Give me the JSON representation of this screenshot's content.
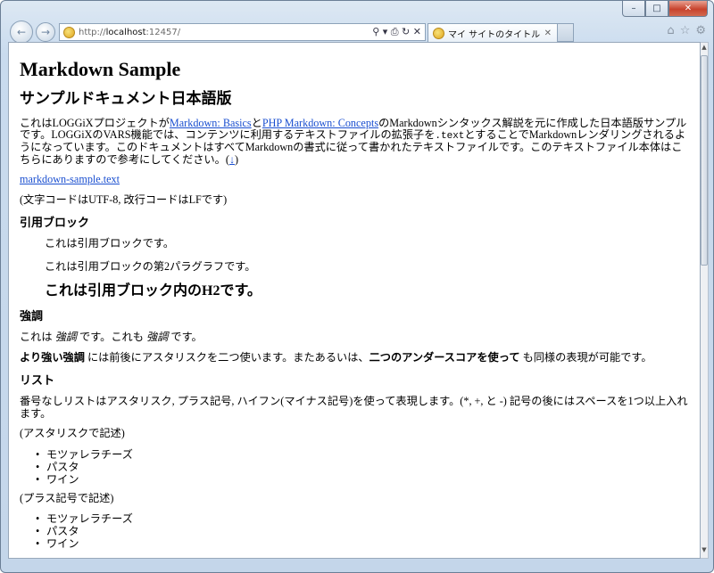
{
  "window": {
    "minimize_glyph": "–",
    "maximize_glyph": "□",
    "close_glyph": "✕"
  },
  "nav": {
    "back_glyph": "←",
    "forward_glyph": "→",
    "url_prefix": "http://",
    "url_host": "localhost",
    "url_rest": ":12457/",
    "tools_glyphs": "⚲ ▾ ⎙ ↻ ✕",
    "tab_title": "マイ サイトのタイトル",
    "tab_close": "✕",
    "home_glyph": "⌂",
    "favorites_glyph": "☆",
    "settings_glyph": "⚙"
  },
  "scrollbar": {
    "up": "▲",
    "down": "▼"
  },
  "doc": {
    "title": "Markdown Sample",
    "subtitle": "サンプルドキュメント日本語版",
    "intro": {
      "t1": "これはLOGGiXプロジェクトが",
      "link1": "Markdown: Basics",
      "t2": "と",
      "link2": "PHP Markdown: Concepts",
      "t3": "のMarkdownシンタックス解説を元に作成した日本語版サンプルです。LOGGiXのVARS機能では、コンテンツに利用するテキストファイルの拡張子を",
      "code": ".text",
      "t4": "とすることでMarkdownレンダリングされるようになっています。このドキュメントはすべてMarkdownの書式に従って書かれたテキストファイルです。このテキストファイル本体はこちらにありますので参考にしてください。(",
      "arrow_link": "↓",
      "t5": ")"
    },
    "file_link": "markdown-sample.text",
    "encoding_note": "(文字コードはUTF-8, 改行コードはLFです)",
    "blockquote_heading": "引用ブロック",
    "bq_p1": "これは引用ブロックです。",
    "bq_p2": "これは引用ブロックの第2パラグラフです。",
    "bq_h2": "これは引用ブロック内のH2です。",
    "emphasis_heading": "強調",
    "em_line": {
      "t1": "これは ",
      "em1": "強調",
      "t2": " です。これも ",
      "em2": "強調",
      "t3": " です。"
    },
    "strong_line": {
      "s1": "より強い強調",
      "t1": " には前後にアスタリスクを二つ使います。またあるいは、",
      "s2": "二つのアンダースコアを使って",
      "t2": " も同様の表現が可能です。"
    },
    "list_heading": "リスト",
    "list_intro": "番号なしリストはアスタリスク, プラス記号, ハイフン(マイナス記号)を使って表現します。(*, +, と -) 記号の後にはスペースを1つ以上入れます。",
    "asterisk_label": "(アスタリスクで記述)",
    "list_a": [
      "モツァレラチーズ",
      "パスタ",
      "ワイン"
    ],
    "plus_label": "(プラス記号で記述)",
    "list_b": [
      "モツァレラチーズ",
      "パスタ",
      "ワイン"
    ]
  }
}
